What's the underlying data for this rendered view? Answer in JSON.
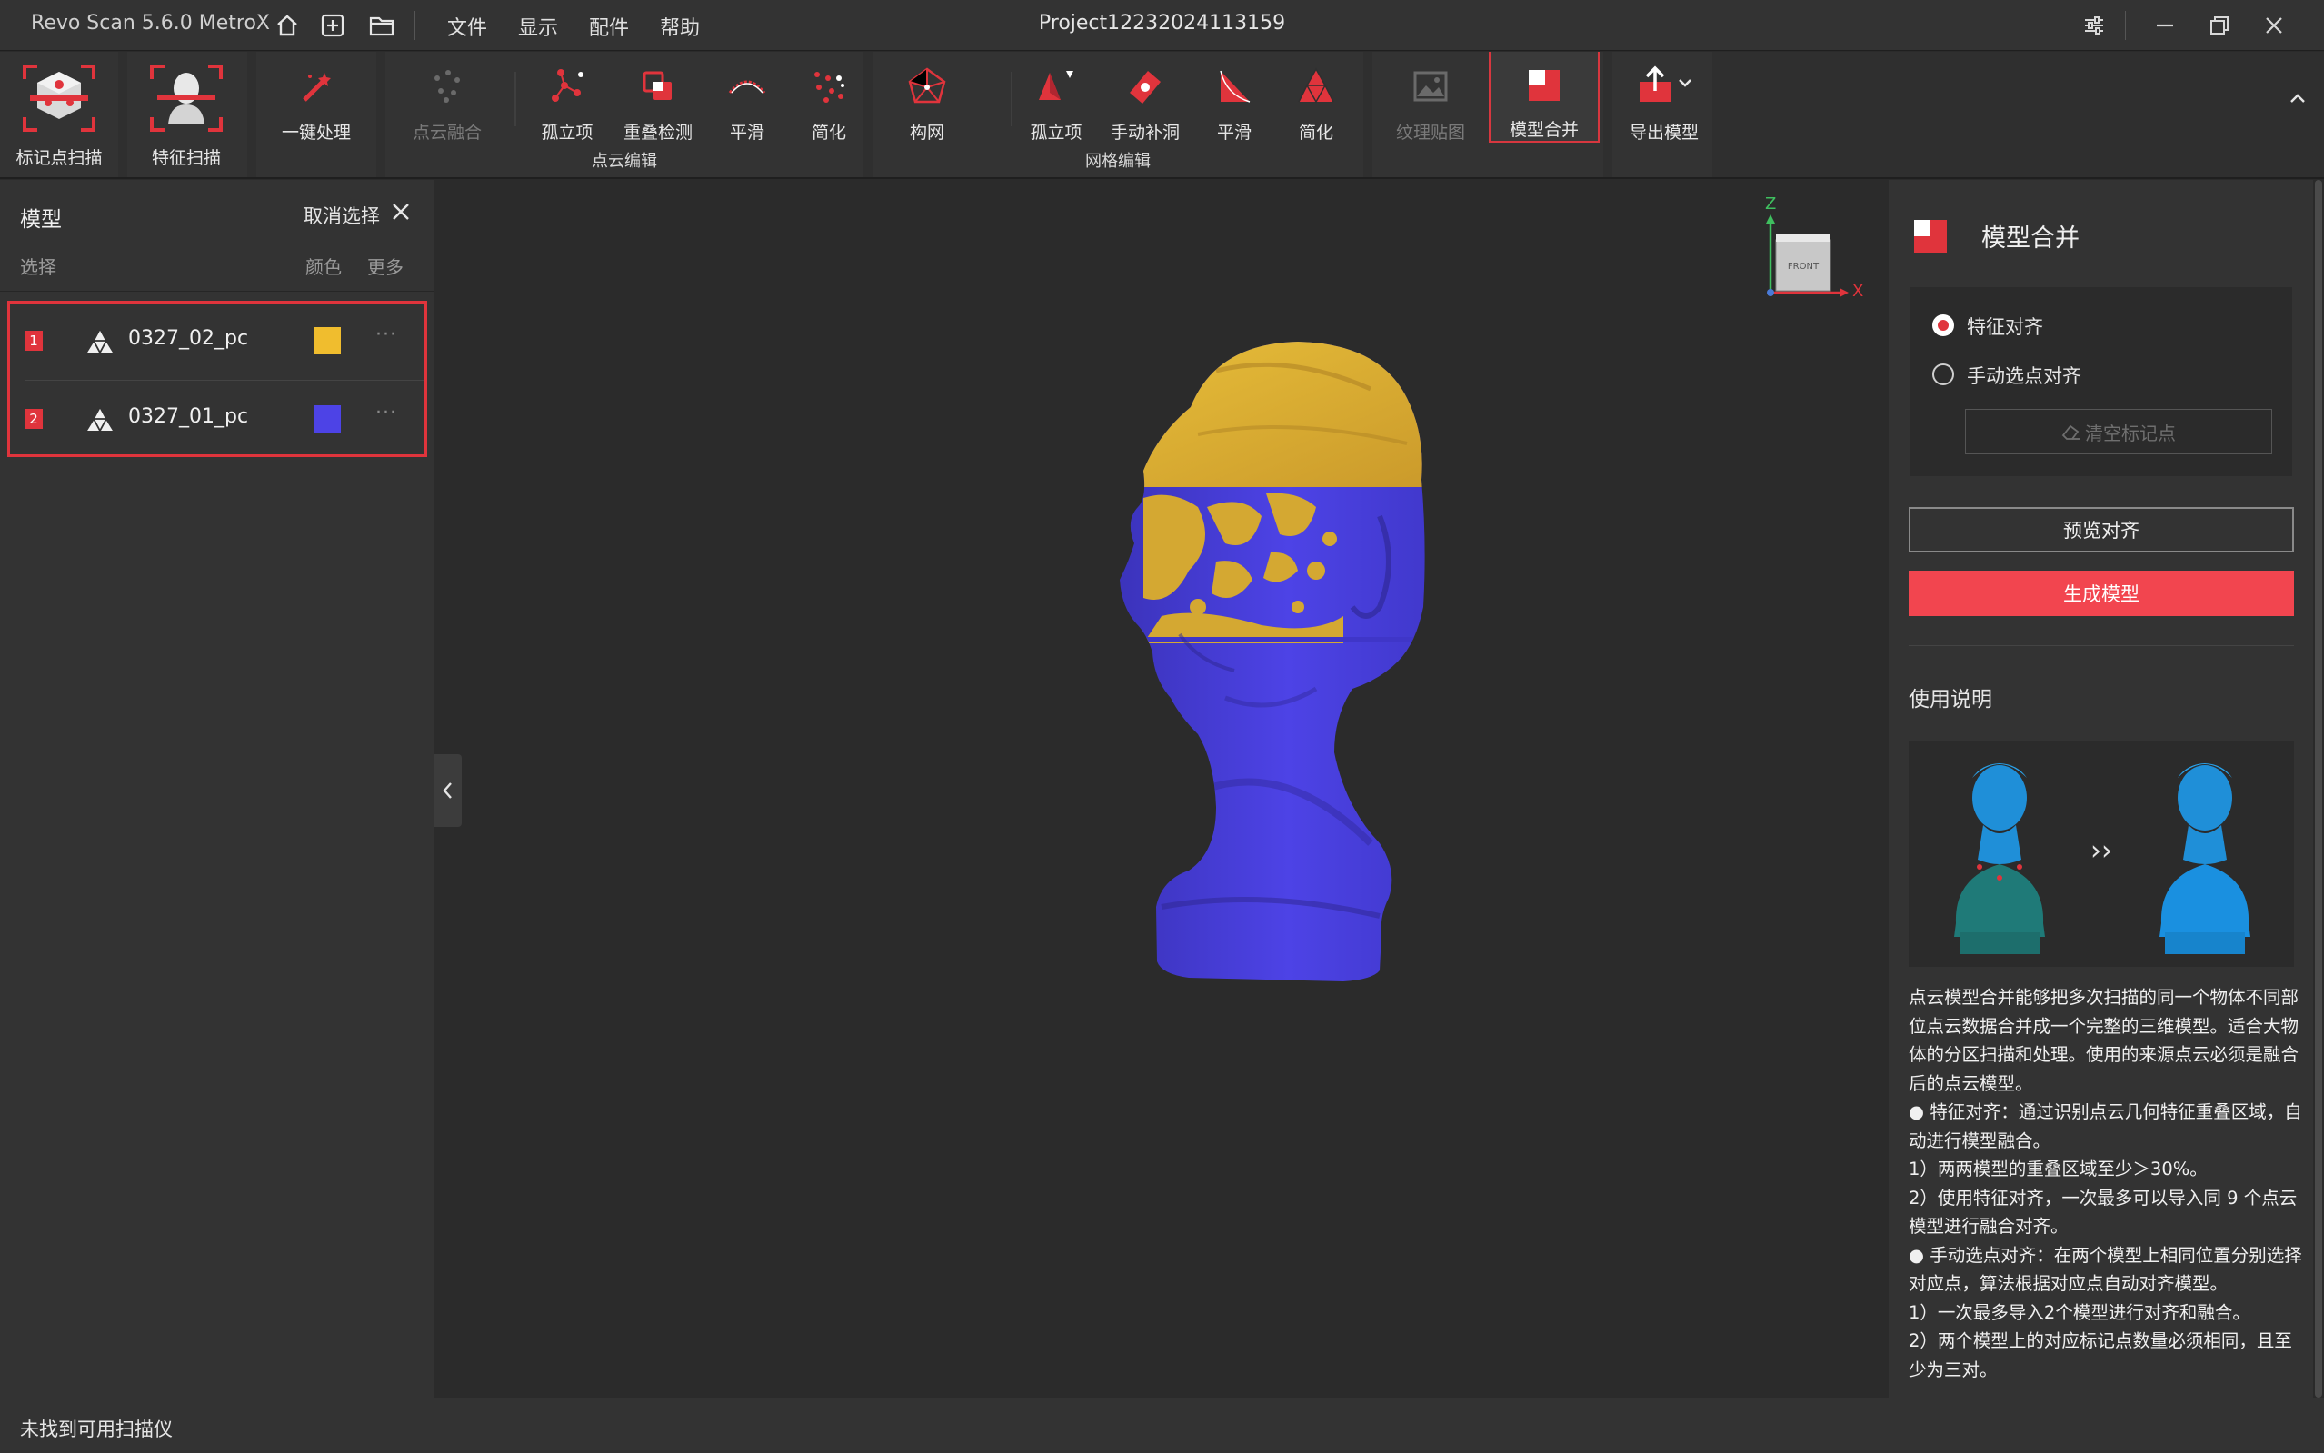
{
  "app_title": "Revo Scan 5.6.0 MetroX",
  "menu": [
    "文件",
    "显示",
    "配件",
    "帮助"
  ],
  "project_title": "Project12232024113159",
  "toolbar_icons": [
    "home-icon",
    "new-project-icon",
    "open-folder-icon"
  ],
  "window_controls": [
    "settings-sliders-icon",
    "minimize-icon",
    "restore-icon",
    "close-icon"
  ],
  "ribbon": {
    "marker_scan": "标记点扫描",
    "feature_scan": "特征扫描",
    "one_click": "一键处理",
    "point_cloud_group": {
      "label": "点云编辑",
      "items": [
        "点云融合",
        "孤立项",
        "重叠检测",
        "平滑",
        "简化"
      ]
    },
    "mesh_group": {
      "label": "网格编辑",
      "items": [
        "构网",
        "孤立项",
        "手动补洞",
        "平滑",
        "简化"
      ]
    },
    "texture": "纹理贴图",
    "merge": "模型合并",
    "export": "导出模型"
  },
  "left_panel": {
    "title": "模型",
    "cancel_select": "取消选择",
    "col_select": "选择",
    "col_color": "颜色",
    "col_more": "更多",
    "models": [
      {
        "index": "1",
        "name": "0327_02_pc",
        "color": "#f0bd2e"
      },
      {
        "index": "2",
        "name": "0327_01_pc",
        "color": "#4d43e6"
      }
    ],
    "more_glyph": "···"
  },
  "axis_gizmo": {
    "z": "Z",
    "x": "X",
    "face": "FRONT"
  },
  "right_panel": {
    "title": "模型合并",
    "options": [
      "特征对齐",
      "手动选点对齐"
    ],
    "selected_option": "特征对齐",
    "clear_markers": "清空标记点",
    "preview_align": "预览对齐",
    "generate_model": "生成模型",
    "usage_title": "使用说明",
    "usage_arrow": "››",
    "usage_lines": [
      "点云模型合并能够把多次扫描的同一个物体不同部位点云数据合并成一个完整的三维模型。适合大物体的分区扫描和处理。使用的来源点云必须是融合后的点云模型。",
      "● 特征对齐：通过识别点云几何特征重叠区域，自动进行模型融合。",
      "1）两两模型的重叠区域至少＞30%。",
      "2）使用特征对齐，一次最多可以导入同 9 个点云模型进行融合对齐。",
      "● 手动选点对齐：在两个模型上相同位置分别选择对应点，算法根据对应点自动对齐模型。",
      "1）一次最多导入2个模型进行对齐和融合。",
      "2）两个模型上的对应标记点数量必须相同，且至少为三对。"
    ]
  },
  "colors": {
    "accent": "#e0343c",
    "button_red": "#f2454f",
    "yellow": "#e8b82f",
    "blue": "#4a3fd8"
  },
  "status": "未找到可用扫描仪"
}
